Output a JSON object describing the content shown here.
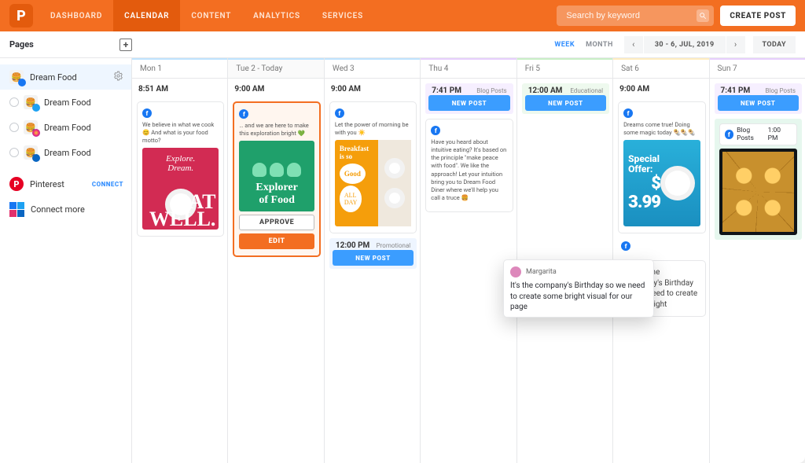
{
  "nav": {
    "tabs": [
      "DASHBOARD",
      "CALENDAR",
      "CONTENT",
      "ANALYTICS",
      "SERVICES"
    ],
    "active_tab": "CALENDAR",
    "search_placeholder": "Search by keyword",
    "create_post": "CREATE POST"
  },
  "toolbar": {
    "pages_title": "Pages",
    "view": {
      "week": "WEEK",
      "month": "MONTH",
      "active": "WEEK"
    },
    "date_range": "30 - 6, JUL, 2019",
    "today": "TODAY"
  },
  "sidebar": {
    "items": [
      {
        "label": "Dream Food",
        "net": "fb",
        "selected": true,
        "gear": true
      },
      {
        "label": "Dream Food",
        "net": "tw"
      },
      {
        "label": "Dream Food",
        "net": "ig"
      },
      {
        "label": "Dream Food",
        "net": "li"
      }
    ],
    "pinterest": {
      "label": "Pinterest",
      "action": "CONNECT"
    },
    "connect_more": "Connect more"
  },
  "days": [
    {
      "hdr": "Mon 1",
      "bar": "light-blue"
    },
    {
      "hdr": "Tue 2 - Today",
      "bar": "light-blue",
      "today": true
    },
    {
      "hdr": "Wed 3",
      "bar": "light-blue"
    },
    {
      "hdr": "Thu 4",
      "bar": "purple"
    },
    {
      "hdr": "Fri 5",
      "bar": "green"
    },
    {
      "hdr": "Sat 6",
      "bar": "yellow"
    },
    {
      "hdr": "Sun 7",
      "bar": "purple"
    }
  ],
  "mon": {
    "time": "8:51 AM",
    "text": "We believe in what we cook 😊 And what is your food motto?",
    "g_top": "Explore.\nDream.",
    "g_big": "EAT\nWELL."
  },
  "tue": {
    "time": "9:00 AM",
    "text": "… and we are here to make this exploration bright 💚",
    "g_title": "Explorer\nof Food",
    "approve": "APPROVE",
    "edit": "EDIT"
  },
  "wed": {
    "time": "9:00 AM",
    "text": "Let the power of morning be with you ☀️",
    "g_left": "Breakfast\nis so",
    "g_bubble_top": "Good",
    "g_bubble_bot": "ALL\nDAY",
    "slot2_time": "12:00 PM",
    "slot2_tag": "Promotional",
    "newpost": "NEW POST"
  },
  "thu": {
    "slot_time": "7:41 PM",
    "slot_tag": "Blog Posts",
    "newpost": "NEW POST",
    "card_text": "Have you heard about intuitive eating? It's based on the principle \"make peace with food\". We like the approach! Let your intuition bring you to Dream Food Diner where we'll help you call a truce 🍔"
  },
  "fri": {
    "slot_time": "12:00 AM",
    "slot_tag": "Educational",
    "newpost": "NEW POST"
  },
  "sat": {
    "time": "9:00 AM",
    "text": "Dreams come true! Doing some magic today 🌯🌯🌯",
    "g_title": "Special\nOffer:",
    "g_price": "$\n3.99",
    "note_text": "It's the company's Birthday so we need to create some bright"
  },
  "sun": {
    "slot_time": "7:41 PM",
    "slot_tag": "Blog Posts",
    "newpost": "NEW POST",
    "chip_label": "Blog Posts",
    "chip_time": "1:00 PM"
  },
  "floating_note": {
    "author": "Margarita",
    "text": "It's the company's Birthday so we need to create some bright visual for our page"
  }
}
